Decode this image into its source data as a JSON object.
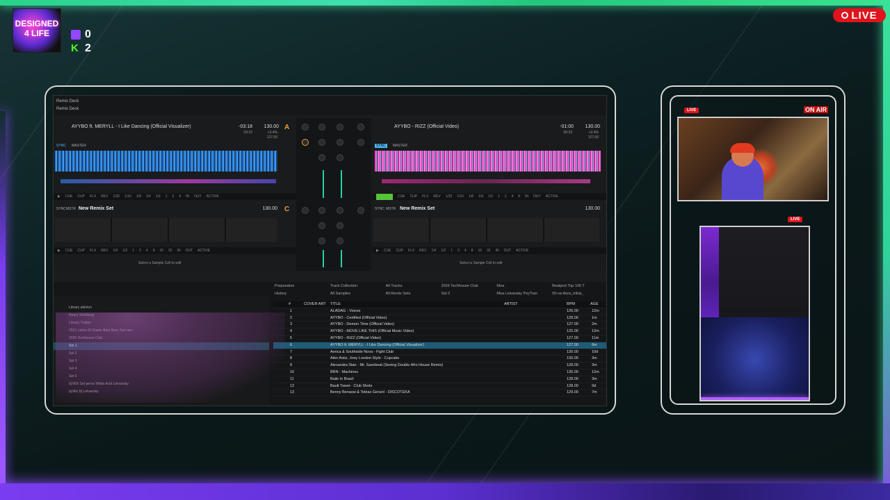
{
  "overlay": {
    "logo_text": "DESIGNED 4 LIFE",
    "twitch_count": "0",
    "kick_icon": "K",
    "kick_count": "2",
    "live_label": "LIVE",
    "cam_live_label": "LIVE",
    "on_air_label": "ON AIR",
    "screen_live_label": "LIVE"
  },
  "app": {
    "header": "Remix Deck",
    "subheader": "Remix Deck"
  },
  "deck_a": {
    "title": "AYYBO ft. MERYLL - I Like Dancing (Official Visualizer)",
    "time": "-03:18",
    "time2": "03:22",
    "bpm": "130.00",
    "pitch": "+2.4%",
    "bpm2": "127.00",
    "letter": "A",
    "sync": "SYNC",
    "master": "MASTER",
    "controls": [
      "CUE",
      "CUP",
      "FLX",
      "REV",
      "1/32",
      "1/16",
      "1/8",
      "1/4",
      "1/2",
      "1",
      "2",
      "4",
      "IN",
      "OUT",
      "ACTIVE"
    ]
  },
  "deck_b": {
    "title": "AYYBO - RIZZ (Official Video)",
    "time": "-01:00",
    "time2": "00:23",
    "bpm": "130.00",
    "pitch": "+2.4%",
    "bpm2": "127.00",
    "sync": "SYNC",
    "master": "MASTER",
    "controls": [
      "CUE",
      "CUP",
      "FLX",
      "REV",
      "1/32",
      "1/16",
      "1/8",
      "1/4",
      "1/2",
      "1",
      "2",
      "4",
      "8",
      "IN",
      "OUT",
      "ACTIVE"
    ]
  },
  "remix_c": {
    "sync": "SYNC",
    "master": "MSTR",
    "title": "New Remix Set",
    "bpm": "130.00",
    "letter": "C",
    "controls": [
      "CUE",
      "CUP",
      "FLX",
      "REV",
      "1/4",
      "1/2",
      "1",
      "2",
      "4",
      "8",
      "16",
      "32",
      "IN",
      "OUT",
      "ACTIVE"
    ],
    "hint": "Select a Sample Cell to edit"
  },
  "remix_d": {
    "sync": "SYNC",
    "master": "MSTR",
    "title": "New Remix Set",
    "bpm": "130.00",
    "controls": [
      "CUE",
      "CUP",
      "FLX",
      "REV",
      "1/4",
      "1/2",
      "1",
      "2",
      "4",
      "8",
      "16",
      "32",
      "IN",
      "OUT",
      "ACTIVE"
    ],
    "hint": "Select a Sample Cell to edit"
  },
  "browser": {
    "tabs_row1": [
      "Preparation",
      "Track Collection",
      "All Tracks",
      "2026 Techhouse Club",
      "Moa",
      "Beatport Top 100 T"
    ],
    "tabs_row2": [
      "History",
      "All Samples",
      "All Remix Sets",
      "Set 2",
      "Moa Lelvansky PsyTran",
      "00-va-ibiza_tribal_"
    ],
    "tree": [
      "Library ableton",
      "library Steinberg",
      "Library Traktor",
      "2021 Latino Di Snake Bam Bam Tam tam",
      "2026 Techhouse Club",
      "Set 1",
      "Set 2",
      "Set 3",
      "Set 4",
      "Set 5",
      "dj MIX Set peron Wilde Acht Lelvansky",
      "dj Mix Dj Lelvansky"
    ],
    "columns": [
      "#",
      "COVER ART",
      "TITLE",
      "ARTIST",
      "BPM",
      "AGE"
    ],
    "rows": [
      {
        "n": "1",
        "title": "ALADAG - Voices",
        "bpm": "126.00",
        "age": "12m"
      },
      {
        "n": "2",
        "title": "AYYBO - Certified (Official Video)",
        "bpm": "128.00",
        "age": "1m"
      },
      {
        "n": "3",
        "title": "AYYBO - Demon Time (Official Video)",
        "bpm": "127.00",
        "age": "2m"
      },
      {
        "n": "4",
        "title": "AYYBO - MOVE LIKE THIS (Official Music Video)",
        "bpm": "125.00",
        "age": "12m"
      },
      {
        "n": "5",
        "title": "AYYBO - RIZZ (Official Video)",
        "bpm": "127.00",
        "age": "11m"
      },
      {
        "n": "6",
        "title": "AYYBO ft. MERYLL - I Like Dancing (Official Visualizer)",
        "bpm": "127.00",
        "age": "6m"
      },
      {
        "n": "7",
        "title": "Aerica & Southside Nova - Fight Club",
        "bpm": "130.00",
        "age": "10d"
      },
      {
        "n": "8",
        "title": "Aitor Astiz, Joey London Style - Cupcake",
        "bpm": "130.00",
        "age": "3m"
      },
      {
        "n": "9",
        "title": "Alexandra Stan - Mr. Saxobeat (Seeing Double Afro House Remix)",
        "bpm": "128.00",
        "age": "3m"
      },
      {
        "n": "10",
        "title": "BRN - Machines",
        "bpm": "130.00",
        "age": "12m"
      },
      {
        "n": "11",
        "title": "Baile In Brazil",
        "bpm": "128.00",
        "age": "3m"
      },
      {
        "n": "12",
        "title": "Bault Tweet - Club Shots",
        "bpm": "128.00",
        "age": "9d"
      },
      {
        "n": "13",
        "title": "Benny Benassi & Tobias Gerard - DISCOTEKA",
        "bpm": "129.00",
        "age": "7m"
      }
    ]
  },
  "colors": {
    "accent_green": "#3fe0a0",
    "accent_purple": "#8a4bff",
    "deck_a_letter": "#f0a030",
    "selected_row": "#1d5b78",
    "live_red": "#e0141c"
  }
}
